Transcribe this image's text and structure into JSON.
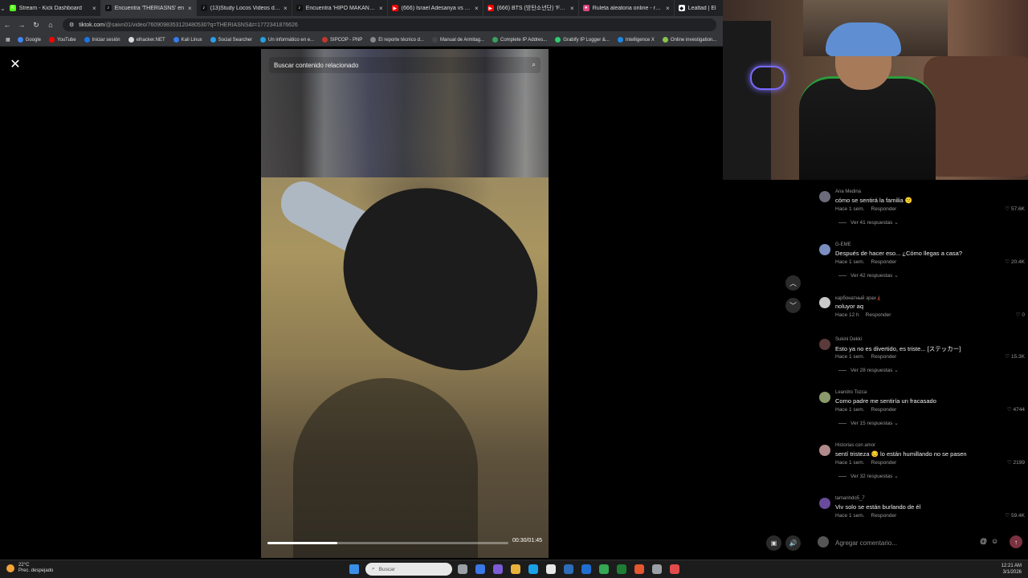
{
  "tabs": [
    {
      "label": "Stream - Kick Dashboard",
      "color": "#53fc18",
      "glyph": "K",
      "active": false
    },
    {
      "label": "Encuentra 'THERIASNS' en",
      "color": "#111111",
      "glyph": "♪",
      "active": true
    },
    {
      "label": "(13)Study Locos Videos de Do",
      "color": "#111111",
      "glyph": "♪",
      "active": false
    },
    {
      "label": "Encuentra 'HIPO MAKANAOKI'",
      "color": "#111111",
      "glyph": "♪",
      "active": false
    },
    {
      "label": "(666) Israel Adesanya vs Alex P",
      "color": "#ff0000",
      "glyph": "▶",
      "active": false
    },
    {
      "label": "(666) BTS (방탄소년단) 'FAKE L",
      "color": "#ff0000",
      "glyph": "▶",
      "active": false
    },
    {
      "label": "Ruleta aleatoria online - ruleta",
      "color": "#e0457b",
      "glyph": "●",
      "active": false
    },
    {
      "label": "Lealtad | El",
      "color": "#ffffff",
      "glyph": "◆",
      "active": false
    }
  ],
  "address": {
    "domain": "tiktok.com",
    "path": "/@saivn01/video/7609098353120480530?q=THERIASNS&t=1772341876626"
  },
  "bookmarks": [
    {
      "label": "Google",
      "color": "#4285f4"
    },
    {
      "label": "YouTube",
      "color": "#ff0000"
    },
    {
      "label": "Iniciar sesión",
      "color": "#1b74e8"
    },
    {
      "label": "elhacker.NET",
      "color": "#d9d9d9"
    },
    {
      "label": "Kali Linux",
      "color": "#367bf0"
    },
    {
      "label": "Social Searcher",
      "color": "#2b9ee8"
    },
    {
      "label": "Un informático en e...",
      "color": "#25a0e0"
    },
    {
      "label": "SIPCOP - PNP",
      "color": "#c0392b"
    },
    {
      "label": "El reporte técnico d...",
      "color": "#888888"
    },
    {
      "label": "Manual de Armitag...",
      "color": "#444444"
    },
    {
      "label": "Complete IP Addres...",
      "color": "#3aa15a"
    },
    {
      "label": "Grabify IP Logger &...",
      "color": "#2ecc71"
    },
    {
      "label": "Intelligence X",
      "color": "#1e88e5"
    },
    {
      "label": "Online investigation...",
      "color": "#8bc34a"
    }
  ],
  "video": {
    "search_placeholder": "Buscar contenido relacionado",
    "timecode": "00:30/01:45",
    "progress": 0.29
  },
  "comments": [
    {
      "name": "Ana Medina",
      "text": "cómo se sentirá la familia 😕",
      "time": "Hace 1 sem.",
      "reply": "Responder",
      "likes": "♡ 57.6K",
      "replies": "Ver 41 respuestas ⌄",
      "avatar": "#6b6b7a"
    },
    {
      "name": "G-EME",
      "text": "Después de hacer eso... ¿Cómo llegas a casa?",
      "time": "Hace 1 sem.",
      "reply": "Responder",
      "likes": "♡ 20.4K",
      "replies": "Ver 42 respuestas ⌄",
      "avatar": "#7a8fbf"
    },
    {
      "name": "карбонатный эрах🗼",
      "text": "noluyor aq",
      "time": "Hace 12 h",
      "reply": "Responder",
      "likes": "♡ 0",
      "replies": "",
      "avatar": "#c9c9c9"
    },
    {
      "name": "Sukini Dekki",
      "text": "Esto ya no es divertido, es triste... [ステッカー]",
      "time": "Hace 1 sem.",
      "reply": "Responder",
      "likes": "♡ 15.3K",
      "replies": "Ver 28 respuestas ⌄",
      "avatar": "#5a3a3a"
    },
    {
      "name": "Leandro Tozca",
      "text": "Como padre me sentiría un fracasado",
      "time": "Hace 1 sem.",
      "reply": "Responder",
      "likes": "♡ 4744",
      "replies": "Ver 15 respuestas ⌄",
      "avatar": "#8a9a6a"
    },
    {
      "name": "Historias con amor",
      "text": "sentí tristeza 😔 lo están humillando no se pasen",
      "time": "Hace 1 sem.",
      "reply": "Responder",
      "likes": "♡ 2199",
      "replies": "Ver 32 respuestas ⌄",
      "avatar": "#b08a8a"
    },
    {
      "name": "tamarindo5_7",
      "text": "Viv solo se están burlando de él",
      "time": "Hace 1 sem.",
      "reply": "Responder",
      "likes": "♡ 59.4K",
      "replies": "",
      "avatar": "#6a4a9a"
    }
  ],
  "comment_input": {
    "placeholder": "Agregar comentario..."
  },
  "taskbar": {
    "temperature": "22°C",
    "weather": "Prec. despejado",
    "search_placeholder": "Buscar",
    "time": "12:21 AM",
    "date": "3/1/2026",
    "app_icons": [
      "#9aa0a6",
      "#3b78e7",
      "#7b5cd6",
      "#e8b13a",
      "#1aa1e8",
      "#e8e8e8",
      "#2d6db8",
      "#1f6fd1",
      "#34a853",
      "#1e7e34",
      "#e5572f",
      "#9aa0a6",
      "#e24b4b"
    ]
  }
}
